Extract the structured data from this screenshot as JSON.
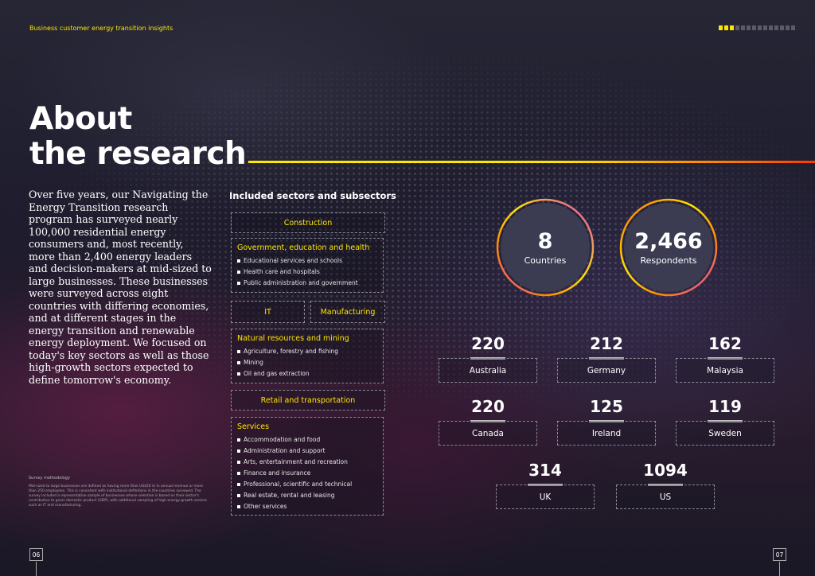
{
  "header": {
    "label": "Business customer energy transition insights"
  },
  "progress": {
    "total": 14,
    "active": 3
  },
  "title": {
    "line1": "About",
    "line2": "the research"
  },
  "intro": "Over five years, our Navigating the Energy Transition research program has surveyed nearly 100,000 residential energy consumers and, most recently, more than 2,400 energy leaders and decision-makers at mid-sized to large businesses. These businesses were surveyed across eight countries with differing economies, and at different stages in the energy transition and renewable energy deployment. We focused on today's key sectors as well as those high-growth sectors expected to define tomorrow's economy.",
  "methodology": {
    "heading": "Survey methodology",
    "text": "Mid-sized to large businesses are defined as having more than US$50 m in annual revenue or more than 250 employees. This is consistent with institutional definitions in the countries surveyed. The survey included a representative sample of businesses whose selection is based on their sector's contribution to gross domestic product (GDP), with additional sampling of high-energy-growth sectors such as IT and manufacturing."
  },
  "sectors": {
    "title": "Included sectors and subsectors",
    "construction": "Construction",
    "government": {
      "heading": "Government, education and health",
      "items": [
        "Educational services and schools",
        "Health care and hospitals",
        "Public administration and government"
      ]
    },
    "it": "IT",
    "manufacturing": "Manufacturing",
    "natural": {
      "heading": "Natural resources and mining",
      "items": [
        "Agriculture, forestry and fishing",
        "Mining",
        "Oil and gas extraction"
      ]
    },
    "retail": "Retail and transportation",
    "services": {
      "heading": "Services",
      "items": [
        "Accommodation and food",
        "Administration and support",
        "Arts, entertainment and recreation",
        "Finance and insurance",
        "Professional, scientific and technical",
        "Real estate, rental and leasing",
        "Other services"
      ]
    }
  },
  "summary": {
    "countries": {
      "value": "8",
      "label": "Countries"
    },
    "respondents": {
      "value": "2,466",
      "label": "Respondents"
    }
  },
  "countries": [
    {
      "value": "220",
      "name": "Australia"
    },
    {
      "value": "212",
      "name": "Germany"
    },
    {
      "value": "162",
      "name": "Malaysia"
    },
    {
      "value": "220",
      "name": "Canada"
    },
    {
      "value": "125",
      "name": "Ireland"
    },
    {
      "value": "119",
      "name": "Sweden"
    },
    {
      "value": "314",
      "name": "UK"
    },
    {
      "value": "1094",
      "name": "US"
    }
  ],
  "pages": {
    "left": "06",
    "right": "07"
  },
  "colors": {
    "accent": "#ffe600",
    "orange": "#ff6a00",
    "magenta": "#e040c8"
  }
}
